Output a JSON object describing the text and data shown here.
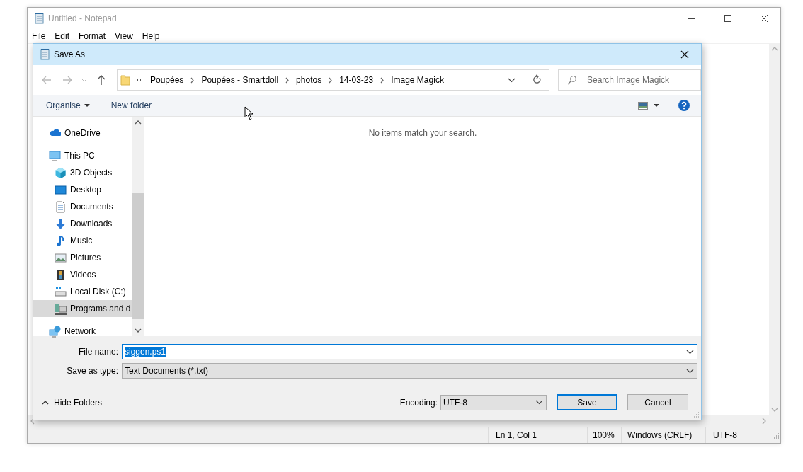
{
  "notepad": {
    "title": "Untitled - Notepad",
    "active": false,
    "menu": [
      "File",
      "Edit",
      "Format",
      "View",
      "Help"
    ],
    "status_bar": [
      "Ln 1, Col 1",
      "100%",
      "Windows (CRLF)",
      "UTF-8"
    ]
  },
  "dialog": {
    "title": "Save As",
    "breadcrumbs": [
      "Poupées",
      "Poupées - Smartdoll",
      "photos",
      "14-03-23",
      "Image Magick"
    ],
    "search": {
      "placeholder": "Search Image Magick"
    },
    "toolbar": [
      {
        "label": "Organise",
        "kind": "menu"
      },
      {
        "label": "New folder",
        "kind": "button"
      }
    ],
    "sidebar": {
      "items": [
        {
          "label": "OneDrive",
          "selected": false
        },
        {
          "label": "This PC",
          "selected": false,
          "children": [
            {
              "label": "3D Objects",
              "selected": false
            },
            {
              "label": "Desktop",
              "selected": false
            },
            {
              "label": "Documents",
              "selected": false
            },
            {
              "label": "Downloads",
              "selected": false
            },
            {
              "label": "Music",
              "selected": false
            },
            {
              "label": "Pictures",
              "selected": false
            },
            {
              "label": "Videos",
              "selected": false
            },
            {
              "label": "Local Disk (C:)",
              "selected": false
            },
            {
              "label": "Programs and d",
              "selected": true
            }
          ]
        },
        {
          "label": "Network",
          "selected": false
        }
      ]
    },
    "empty_message": "No items match your search.",
    "file_name": {
      "label": "File name:",
      "value": "siggen.ps1",
      "value_selected": true
    },
    "save_as_type": {
      "label": "Save as type:",
      "value": "Text Documents (*.txt)"
    },
    "hide_folders": "Hide Folders",
    "encoding": {
      "label": "Encoding:",
      "value": "UTF-8"
    },
    "buttons": [
      {
        "label": "Save",
        "default": true
      },
      {
        "label": "Cancel",
        "default": false
      }
    ]
  }
}
